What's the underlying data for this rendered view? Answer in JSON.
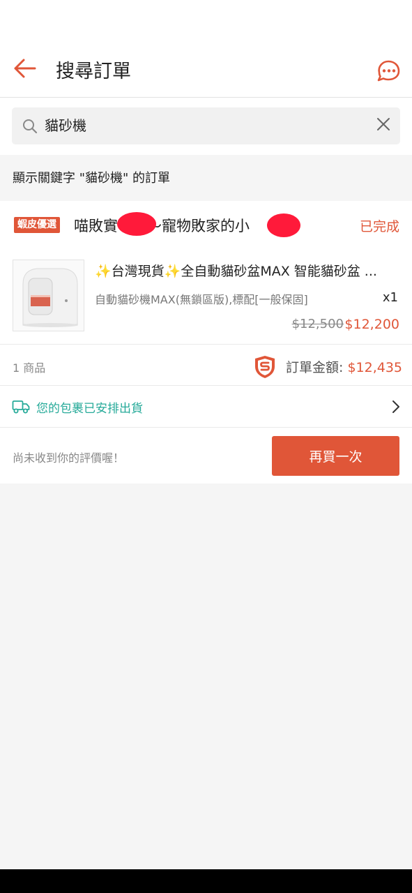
{
  "header": {
    "title": "搜尋訂單"
  },
  "search": {
    "value": "貓砂機"
  },
  "keyword_bar": {
    "text": "顯示關鍵字 \"貓砂機\" 的訂單"
  },
  "order": {
    "preferred_badge": "蝦皮優選",
    "shop_name": "喵敗實　　～寵物敗家的小　",
    "status": "已完成",
    "product": {
      "title": "✨台灣現貨✨全自動貓砂盆MAX 智能貓砂盆 ...",
      "variant": "自動貓砂機MAX(無鎖區版),標配[一般保固]",
      "quantity": "x1",
      "price_original": "$12,500",
      "price_sale": "$12,200"
    },
    "item_count": "1 商品",
    "total_label": "訂單金額: ",
    "total_value": "$12,435",
    "shipping_status": "您的包裹已安排出貨",
    "review_prompt": "尚未收到你的評價喔！",
    "rebuy_label": "再買一次"
  },
  "colors": {
    "accent": "#e05638",
    "shipping": "#26aa99"
  },
  "icons": {
    "back": "back-arrow-icon",
    "chat": "chat-bubble-icon",
    "search": "search-icon",
    "clear": "close-icon",
    "shield": "shopee-guarantee-icon",
    "truck": "truck-icon",
    "chevron": "chevron-right-icon"
  }
}
